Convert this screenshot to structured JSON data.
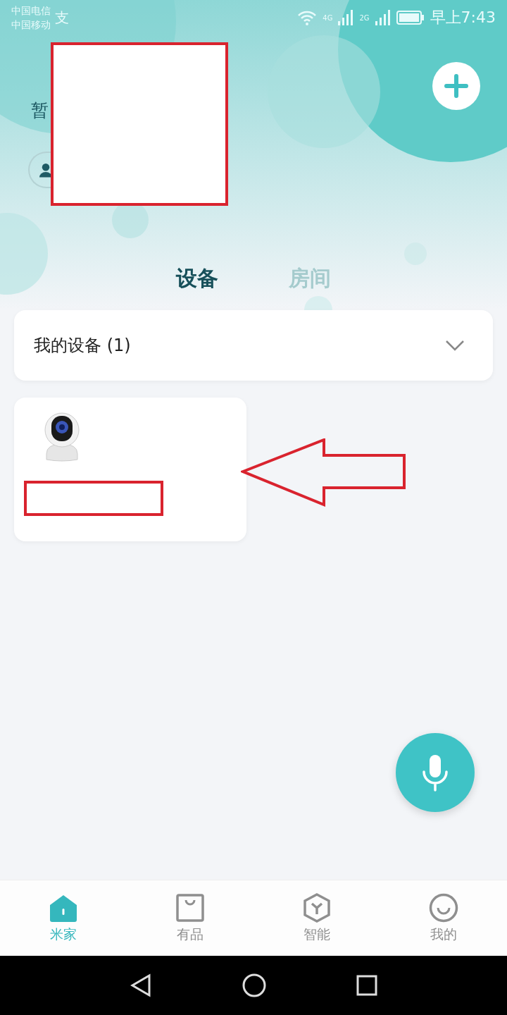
{
  "status_bar": {
    "carriers": [
      "中国电信",
      "中国移动"
    ],
    "carrier_badge": "支",
    "network_1": "4G",
    "network_2": "2G",
    "time": "早上7:43"
  },
  "header": {
    "subtitle": "暂"
  },
  "tabs": [
    {
      "label": "设备",
      "selected": true
    },
    {
      "label": "房间",
      "selected": false
    }
  ],
  "device_group": {
    "title": "我的设备 (1)",
    "expanded": false
  },
  "nav": [
    {
      "label": "米家",
      "selected": true,
      "kind": "home"
    },
    {
      "label": "有品",
      "selected": false,
      "kind": "bag"
    },
    {
      "label": "智能",
      "selected": false,
      "kind": "hex"
    },
    {
      "label": "我的",
      "selected": false,
      "kind": "smile"
    }
  ]
}
